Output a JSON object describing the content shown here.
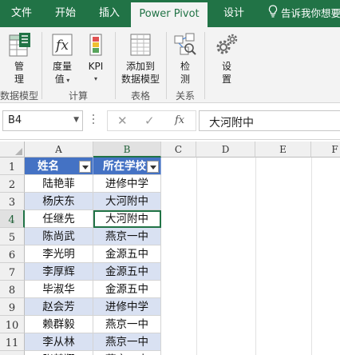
{
  "tabs": [
    {
      "label": "文件",
      "active": false
    },
    {
      "label": "开始",
      "active": false
    },
    {
      "label": "插入",
      "active": false
    },
    {
      "label": "Power Pivot",
      "active": true
    },
    {
      "label": "设计",
      "active": false
    }
  ],
  "tell_me": "告诉我你想要",
  "ribbon": {
    "manage": {
      "line1": "管",
      "line2": "理"
    },
    "measures": {
      "line1": "度量",
      "line2": "值"
    },
    "kpi": {
      "line1": "KPI"
    },
    "add_to_model": {
      "line1": "添加到",
      "line2": "数据模型"
    },
    "detect": {
      "line1": "检",
      "line2": "测"
    },
    "settings": {
      "line1": "设",
      "line2": "置"
    },
    "groups": {
      "data_model": "数据模型",
      "calculations": "计算",
      "tables": "表格",
      "relationships": "关系"
    }
  },
  "formula_bar": {
    "name_box": "B4",
    "cancel": "✕",
    "enter": "✓",
    "fx": "fx",
    "value": "大河附中"
  },
  "columns": [
    "A",
    "B",
    "C",
    "D",
    "E",
    "F"
  ],
  "rows": [
    "1",
    "2",
    "3",
    "4",
    "5",
    "6",
    "7",
    "8",
    "9",
    "10",
    "11",
    "12"
  ],
  "selected_cell": "B4",
  "table": {
    "headers": [
      "姓名",
      "所在学校"
    ],
    "data": [
      [
        "陆艳菲",
        "进修中学"
      ],
      [
        "杨庆东",
        "大河附中"
      ],
      [
        "任继先",
        "大河附中"
      ],
      [
        "陈尚武",
        "燕京一中"
      ],
      [
        "李光明",
        "金源五中"
      ],
      [
        "李厚辉",
        "金源五中"
      ],
      [
        "毕淑华",
        "金源五中"
      ],
      [
        "赵会芳",
        "进修中学"
      ],
      [
        "赖群毅",
        "燕京一中"
      ],
      [
        "李从林",
        "燕京一中"
      ],
      [
        "张鹤翔",
        "燕京一中"
      ]
    ]
  },
  "colors": {
    "accent": "#217346",
    "table_header": "#4472c4",
    "table_band": "#d9e1f2"
  }
}
